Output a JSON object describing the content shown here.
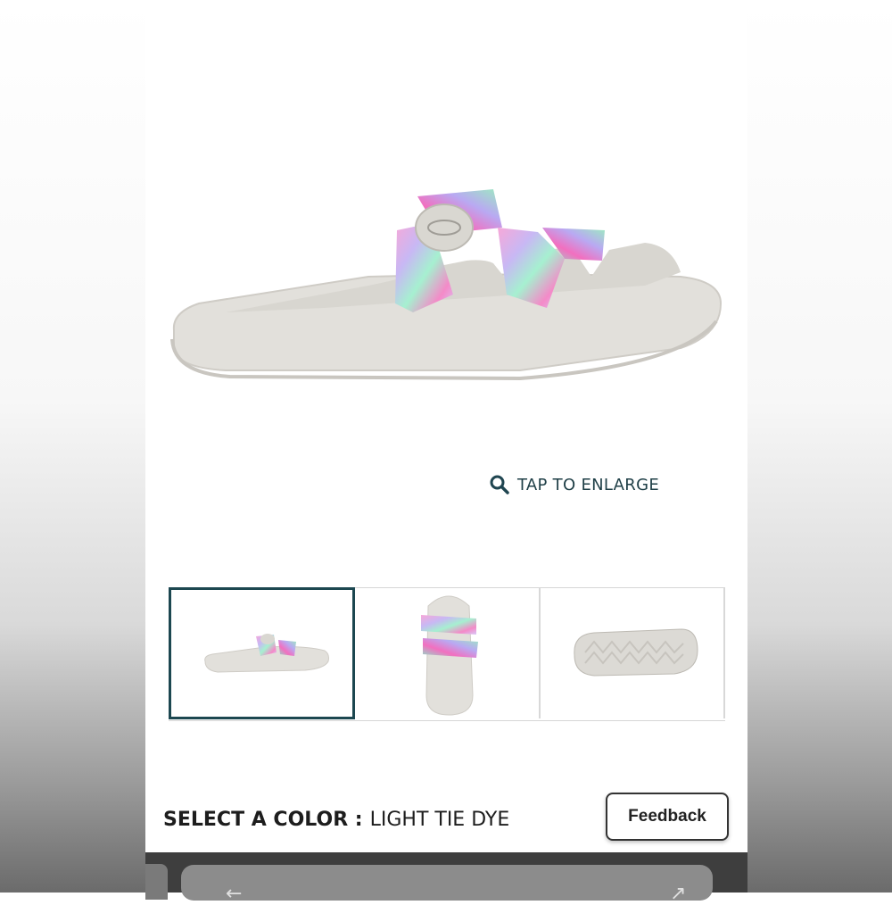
{
  "product": {
    "enlarge_label": "TAP TO ENLARGE",
    "thumbnails": [
      {
        "view": "side view",
        "selected": true
      },
      {
        "view": "top view",
        "selected": false
      },
      {
        "view": "sole view",
        "selected": false
      }
    ]
  },
  "color_selector": {
    "label": "SELECT A COLOR :",
    "value": "LIGHT TIE DYE"
  },
  "feedback": {
    "label": "Feedback"
  },
  "icons": {
    "enlarge": "search-icon",
    "bottom_left": "arrow-icon",
    "bottom_right": "share-icon"
  },
  "colors": {
    "accent": "#1c4750",
    "sole": "#dcdad5",
    "page_bg": "#ffffff"
  }
}
